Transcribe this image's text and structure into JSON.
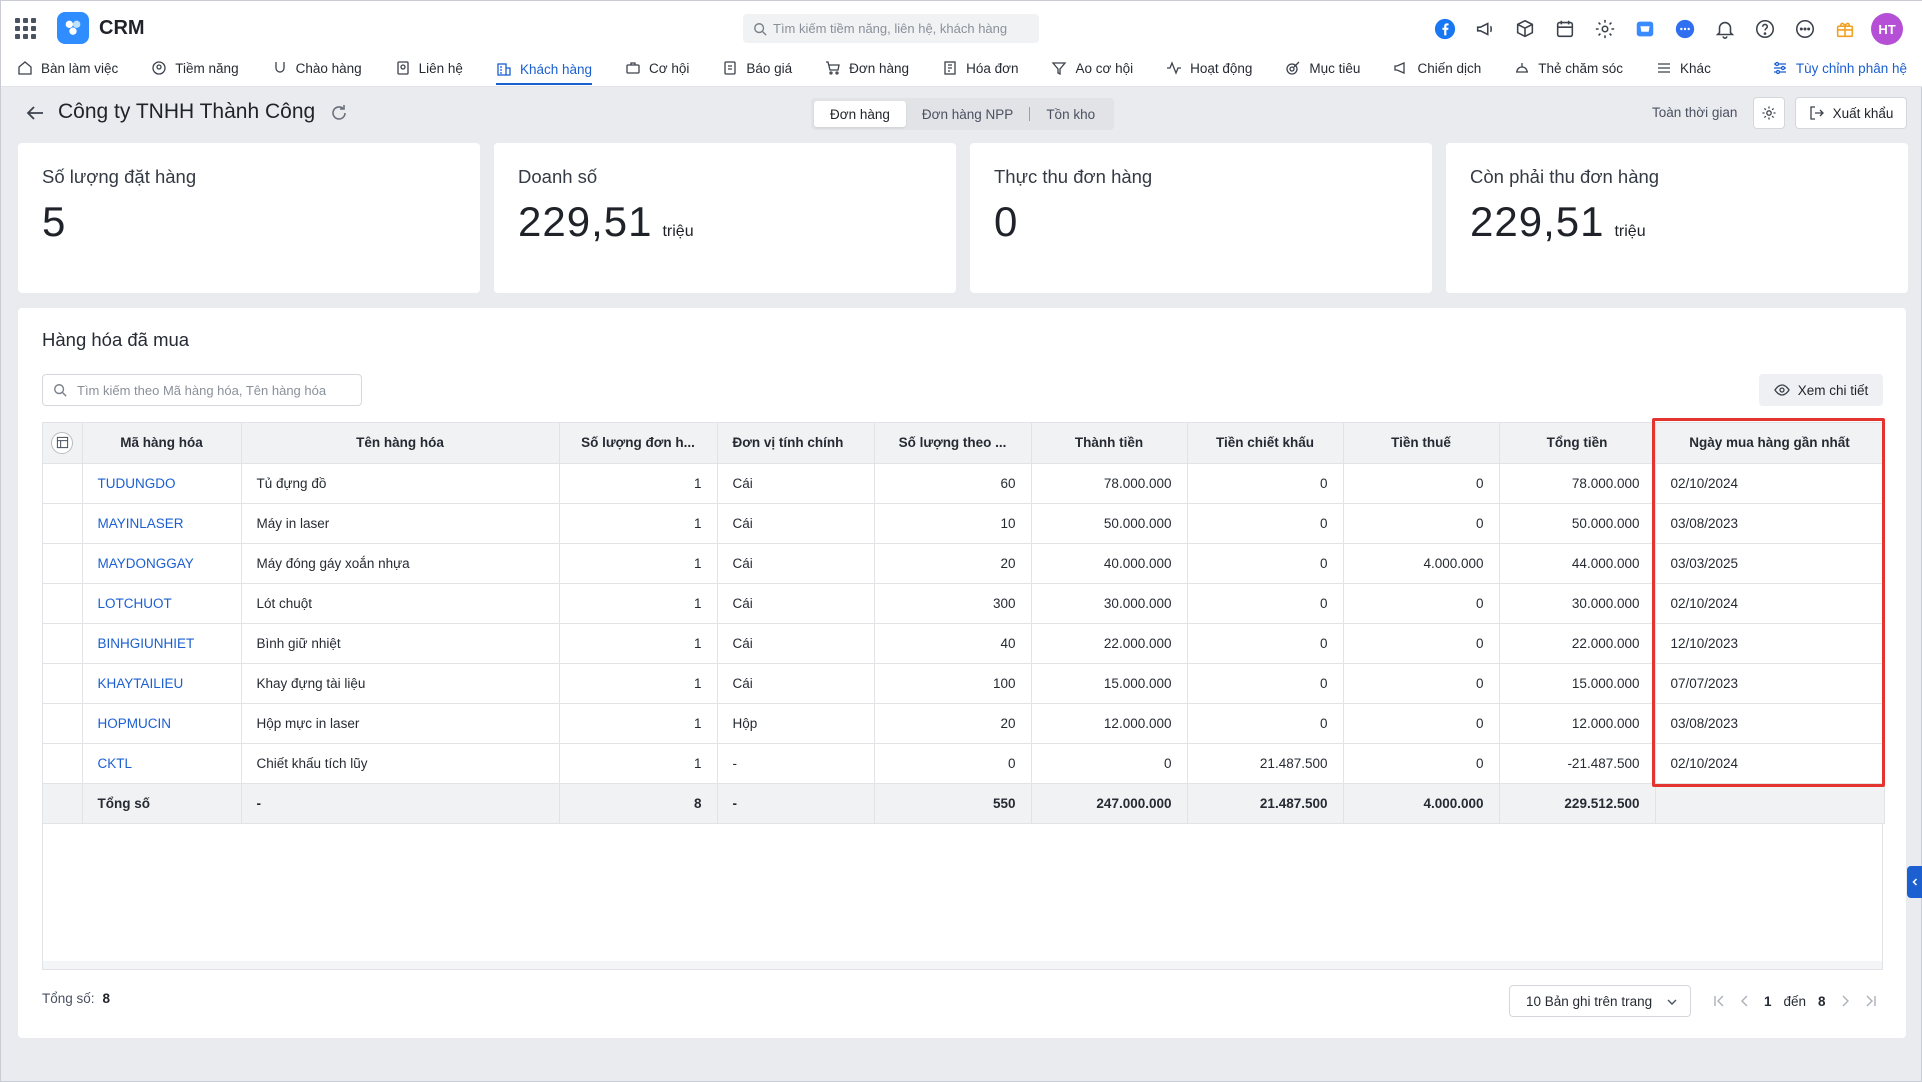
{
  "header": {
    "brand": "CRM",
    "search_placeholder": "Tìm kiếm tiềm năng, liên hệ, khách hàng",
    "avatar_initials": "HT",
    "icons": [
      "facebook-icon",
      "megaphone-icon",
      "package-search-icon",
      "calendar-icon",
      "settings-icon",
      "store-icon",
      "chat-icon",
      "bell-icon",
      "help-icon",
      "more-icon",
      "gift-icon"
    ]
  },
  "nav": {
    "items": [
      {
        "label": "Bàn làm việc",
        "icon": "home-icon"
      },
      {
        "label": "Tiềm năng",
        "icon": "target-user-icon"
      },
      {
        "label": "Chào hàng",
        "icon": "magnet-icon"
      },
      {
        "label": "Liên hệ",
        "icon": "contact-icon"
      },
      {
        "label": "Khách hàng",
        "icon": "building-icon",
        "active": true
      },
      {
        "label": "Cơ hội",
        "icon": "briefcase-icon"
      },
      {
        "label": "Báo giá",
        "icon": "quote-doc-icon"
      },
      {
        "label": "Đơn hàng",
        "icon": "cart-icon"
      },
      {
        "label": "Hóa đơn",
        "icon": "invoice-icon"
      },
      {
        "label": "Ao cơ hội",
        "icon": "funnel-icon"
      },
      {
        "label": "Hoạt động",
        "icon": "activity-icon"
      },
      {
        "label": "Mục tiêu",
        "icon": "goal-icon"
      },
      {
        "label": "Chiến dịch",
        "icon": "campaign-icon"
      },
      {
        "label": "Thẻ chăm sóc",
        "icon": "care-card-icon"
      },
      {
        "label": "Khác",
        "icon": "menu-icon"
      }
    ],
    "customize_label": "Tùy chỉnh phân hệ"
  },
  "page": {
    "title": "Công ty TNHH Thành Công",
    "tabs": [
      {
        "label": "Đơn hàng",
        "active": true
      },
      {
        "label": "Đơn hàng NPP",
        "active": false
      },
      {
        "label": "Tồn kho",
        "active": false
      }
    ],
    "period": "Toàn thời gian",
    "export_label": "Xuất khẩu"
  },
  "kpis": [
    {
      "label": "Số lượng đặt hàng",
      "value": "5",
      "unit": ""
    },
    {
      "label": "Doanh số",
      "value": "229,51",
      "unit": "triệu"
    },
    {
      "label": "Thực thu đơn hàng",
      "value": "0",
      "unit": ""
    },
    {
      "label": "Còn phải thu đơn hàng",
      "value": "229,51",
      "unit": "triệu"
    }
  ],
  "goods": {
    "title": "Hàng hóa đã mua",
    "search_placeholder": "Tìm kiếm theo Mã hàng hóa, Tên hàng hóa",
    "detail_label": "Xem chi tiết",
    "columns": [
      "Mã hàng hóa",
      "Tên hàng hóa",
      "Số lượng đơn h...",
      "Đơn vị tính chính",
      "Số lượng theo ...",
      "Thành tiền",
      "Tiền chiết khấu",
      "Tiền thuế",
      "Tổng tiền",
      "Ngày mua hàng gần nhất"
    ],
    "rows": [
      [
        "TUDUNGDO",
        "Tủ đựng đồ",
        "1",
        "Cái",
        "60",
        "78.000.000",
        "0",
        "0",
        "78.000.000",
        "02/10/2024"
      ],
      [
        "MAYINLASER",
        "Máy in laser",
        "1",
        "Cái",
        "10",
        "50.000.000",
        "0",
        "0",
        "50.000.000",
        "03/08/2023"
      ],
      [
        "MAYDONGGAY",
        "Máy đóng gáy xoắn nhựa",
        "1",
        "Cái",
        "20",
        "40.000.000",
        "0",
        "4.000.000",
        "44.000.000",
        "03/03/2025"
      ],
      [
        "LOTCHUOT",
        "Lót chuột",
        "1",
        "Cái",
        "300",
        "30.000.000",
        "0",
        "0",
        "30.000.000",
        "02/10/2024"
      ],
      [
        "BINHGIUNHIET",
        "Bình giữ nhiệt",
        "1",
        "Cái",
        "40",
        "22.000.000",
        "0",
        "0",
        "22.000.000",
        "12/10/2023"
      ],
      [
        "KHAYTAILIEU",
        "Khay đựng tài liệu",
        "1",
        "Cái",
        "100",
        "15.000.000",
        "0",
        "0",
        "15.000.000",
        "07/07/2023"
      ],
      [
        "HOPMUCIN",
        "Hộp mực in laser",
        "1",
        "Hộp",
        "20",
        "12.000.000",
        "0",
        "0",
        "12.000.000",
        "03/08/2023"
      ],
      [
        "CKTL",
        "Chiết khấu tích lũy",
        "1",
        "-",
        "0",
        "0",
        "21.487.500",
        "0",
        "-21.487.500",
        "02/10/2024"
      ]
    ],
    "total_row": [
      "Tổng số",
      "-",
      "8",
      "-",
      "550",
      "247.000.000",
      "21.487.500",
      "4.000.000",
      "229.512.500",
      ""
    ],
    "footer_total_label": "Tổng số:",
    "footer_total_value": "8",
    "page_size_label": "10 Bản ghi trên trang",
    "pager": {
      "from": "1",
      "to_label": "đến",
      "to": "8"
    }
  },
  "colors": {
    "accent": "#1b5fd1",
    "highlight_border": "#e3342f",
    "avatar": "#b44fd6"
  }
}
